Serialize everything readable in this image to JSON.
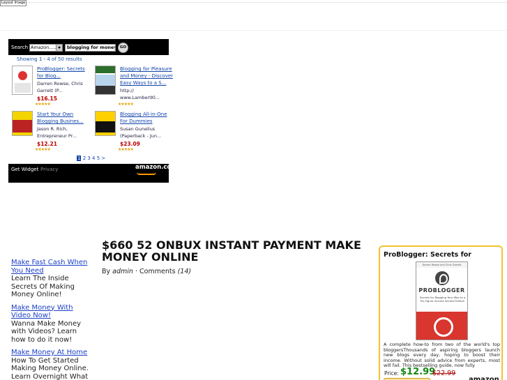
{
  "header": {
    "broken_image_alt": "Layout Image"
  },
  "widget": {
    "search_label": "Search",
    "search_category": "Amazon.....",
    "search_query": "blogging for money",
    "go_label": "GO",
    "results_text": "Showing 1 - 4 of 50 results",
    "products": [
      {
        "title": "ProBlogger: Secrets for Blog...",
        "author": "Darren Rowse, Chris Garrett (P...",
        "price": "$16.15",
        "stars": "★★★★★"
      },
      {
        "title": "Blogging for Pleasure and Money - Discover Easy Ways to a S...",
        "author": "http:// www.LambertKl...",
        "price": "",
        "stars": "★★★★★"
      },
      {
        "title": "Start Your Own Blogging Busines...",
        "author": "Jason R. Rich, Entrepreneur Pr...",
        "price": "$12.21",
        "stars": "★★★★★"
      },
      {
        "title": "Blogging All-in-One For Dummies",
        "author": "Susan Gunelius (Paperback - Jun...",
        "price": "$23.09",
        "stars": "★★★★★"
      }
    ],
    "pager": {
      "current": "1",
      "others": "2 3 4 5 >"
    },
    "get_widget": "Get Widget",
    "privacy": "Privacy",
    "logo_text": "amazon.com"
  },
  "sidebar_ads": [
    {
      "link": "Make Fast Cash When You Need",
      "desc": "Learn The Inside Secrets Of Making Money Online!"
    },
    {
      "link": "Make Money With Video Now!",
      "desc": "Wanna Make Money with Videos? Learn how to do it now!"
    },
    {
      "link": "Make Money At Home",
      "desc": "How To Get Started Making Money Online. Learn Overnight What"
    }
  ],
  "post": {
    "title": "$660 52 ONBUX INSTANT PAYMENT MAKE MONEY ONLINE",
    "by_label": "By",
    "author": "admin",
    "separator": "·",
    "comments_label": "Comments",
    "comments_count": "(14)"
  },
  "product_box": {
    "title": "ProBlogger: Secrets for",
    "cover_top": "Darren Rowse and Chris Garrett",
    "cover_name": "PROBLOGGER",
    "cover_sub": "Secrets for Blogging Your Way to a Six-Figure Income Second Edition",
    "description": "A complete how-to from two of the world's top bloggersThousands of aspiring bloggers launch new blogs every day, hoping to boost their income. Without solid advice from experts, most will fail. This bestselling guide, now fully",
    "price_label": "Price:",
    "price": "$12.99",
    "old_price": "$22.99",
    "logo_text": "amazon"
  }
}
